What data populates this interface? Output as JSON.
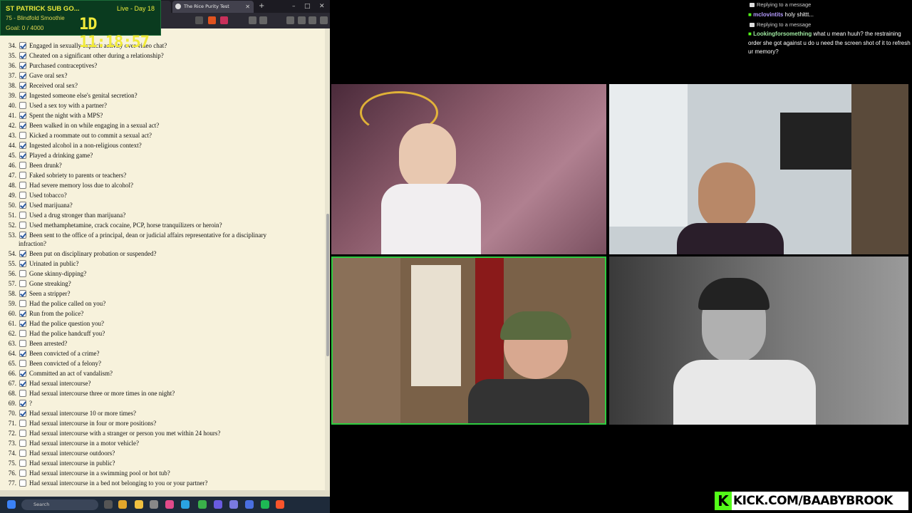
{
  "browser": {
    "tabs": [
      {
        "label": ""
      },
      {
        "label": "The Rice Purity Test"
      }
    ],
    "new_tab": "+",
    "controls": [
      "–",
      "□",
      "✕"
    ]
  },
  "overlay": {
    "title": "ST PATRICK SUB GO...",
    "day": "Live - Day 18",
    "subtitle": "75 - Blindfold Smoothie",
    "goal": "Goal: 0 / 4000",
    "timer": "1D 11:18:57"
  },
  "test": {
    "questions": [
      {
        "num": "34.",
        "checked": true,
        "text": "Engaged in sexually explicit activity over video chat?"
      },
      {
        "num": "35.",
        "checked": true,
        "text": "Cheated on a significant other during a relationship?"
      },
      {
        "num": "36.",
        "checked": true,
        "text": "Purchased contraceptives?"
      },
      {
        "num": "37.",
        "checked": true,
        "text": "Gave oral sex?"
      },
      {
        "num": "38.",
        "checked": true,
        "text": "Received oral sex?"
      },
      {
        "num": "39.",
        "checked": true,
        "text": "Ingested someone else's genital secretion?"
      },
      {
        "num": "40.",
        "checked": false,
        "text": "Used a sex toy with a partner?"
      },
      {
        "num": "41.",
        "checked": true,
        "text": "Spent the night with a MPS?"
      },
      {
        "num": "42.",
        "checked": true,
        "text": "Been walked in on while engaging in a sexual act?"
      },
      {
        "num": "43.",
        "checked": false,
        "text": "Kicked a roommate out to commit a sexual act?"
      },
      {
        "num": "44.",
        "checked": true,
        "text": "Ingested alcohol in a non-religious context?"
      },
      {
        "num": "45.",
        "checked": true,
        "text": "Played a drinking game?"
      },
      {
        "num": "46.",
        "checked": false,
        "text": "Been drunk?"
      },
      {
        "num": "47.",
        "checked": false,
        "text": "Faked sobriety to parents or teachers?"
      },
      {
        "num": "48.",
        "checked": false,
        "text": "Had severe memory loss due to alcohol?"
      },
      {
        "num": "49.",
        "checked": false,
        "text": "Used tobacco?"
      },
      {
        "num": "50.",
        "checked": true,
        "text": "Used marijuana?"
      },
      {
        "num": "51.",
        "checked": false,
        "text": "Used a drug stronger than marijuana?"
      },
      {
        "num": "52.",
        "checked": false,
        "text": "Used methamphetamine, crack cocaine, PCP, horse tranquilizers or heroin?"
      },
      {
        "num": "53.",
        "checked": true,
        "text": "Been sent to the office of a principal, dean or judicial affairs representative for a disciplinary",
        "text2": "infraction?"
      },
      {
        "num": "54.",
        "checked": true,
        "text": "Been put on disciplinary probation or suspended?"
      },
      {
        "num": "55.",
        "checked": true,
        "text": "Urinated in public?"
      },
      {
        "num": "56.",
        "checked": false,
        "text": "Gone skinny-dipping?"
      },
      {
        "num": "57.",
        "checked": false,
        "text": "Gone streaking?"
      },
      {
        "num": "58.",
        "checked": true,
        "text": "Seen a stripper?"
      },
      {
        "num": "59.",
        "checked": false,
        "text": "Had the police called on you?"
      },
      {
        "num": "60.",
        "checked": true,
        "text": "Run from the police?"
      },
      {
        "num": "61.",
        "checked": true,
        "text": "Had the police question you?"
      },
      {
        "num": "62.",
        "checked": false,
        "text": "Had the police handcuff you?"
      },
      {
        "num": "63.",
        "checked": false,
        "text": "Been arrested?"
      },
      {
        "num": "64.",
        "checked": true,
        "text": "Been convicted of a crime?"
      },
      {
        "num": "65.",
        "checked": false,
        "text": "Been convicted of a felony?"
      },
      {
        "num": "66.",
        "checked": true,
        "text": "Committed an act of vandalism?"
      },
      {
        "num": "67.",
        "checked": true,
        "text": "Had sexual intercourse?"
      },
      {
        "num": "68.",
        "checked": false,
        "text": "Had sexual intercourse three or more times in one night?"
      },
      {
        "num": "69.",
        "checked": true,
        "text": "?"
      },
      {
        "num": "70.",
        "checked": true,
        "text": "Had sexual intercourse 10 or more times?"
      },
      {
        "num": "71.",
        "checked": false,
        "text": "Had sexual intercourse in four or more positions?"
      },
      {
        "num": "72.",
        "checked": false,
        "text": "Had sexual intercourse with a stranger or person you met within 24 hours?"
      },
      {
        "num": "73.",
        "checked": false,
        "text": "Had sexual intercourse in a motor vehicle?"
      },
      {
        "num": "74.",
        "checked": false,
        "text": "Had sexual intercourse outdoors?"
      },
      {
        "num": "75.",
        "checked": false,
        "text": "Had sexual intercourse in public?"
      },
      {
        "num": "76.",
        "checked": false,
        "text": "Had sexual intercourse in a swimming pool or hot tub?"
      },
      {
        "num": "77.",
        "checked": false,
        "text": "Had sexual intercourse in a bed not belonging to you or your partner?"
      }
    ]
  },
  "taskbar": {
    "search_placeholder": "Search"
  },
  "chat": {
    "reply1": "Replying to a message",
    "user1": "mclovintits",
    "msg1": "holy shittt...",
    "reply2": "Replying to a message",
    "user2": "Lookingforsomething",
    "msg2": "what u mean huuh? the restraining order she got against u do u need the screen shot of it to refresh ur memory?"
  },
  "kick": {
    "logo": "K",
    "url": "KICK.COM/BAABYBROOK"
  },
  "colors": {
    "page_bg": "#f7f2dc",
    "overlay_bg": "#0a3b1f",
    "timer": "#f1ea3a",
    "kick_green": "#53fc18",
    "active_cam_border": "#2ecc40",
    "user1_color": "#b59cff",
    "user2_color": "#9ee8a0"
  }
}
